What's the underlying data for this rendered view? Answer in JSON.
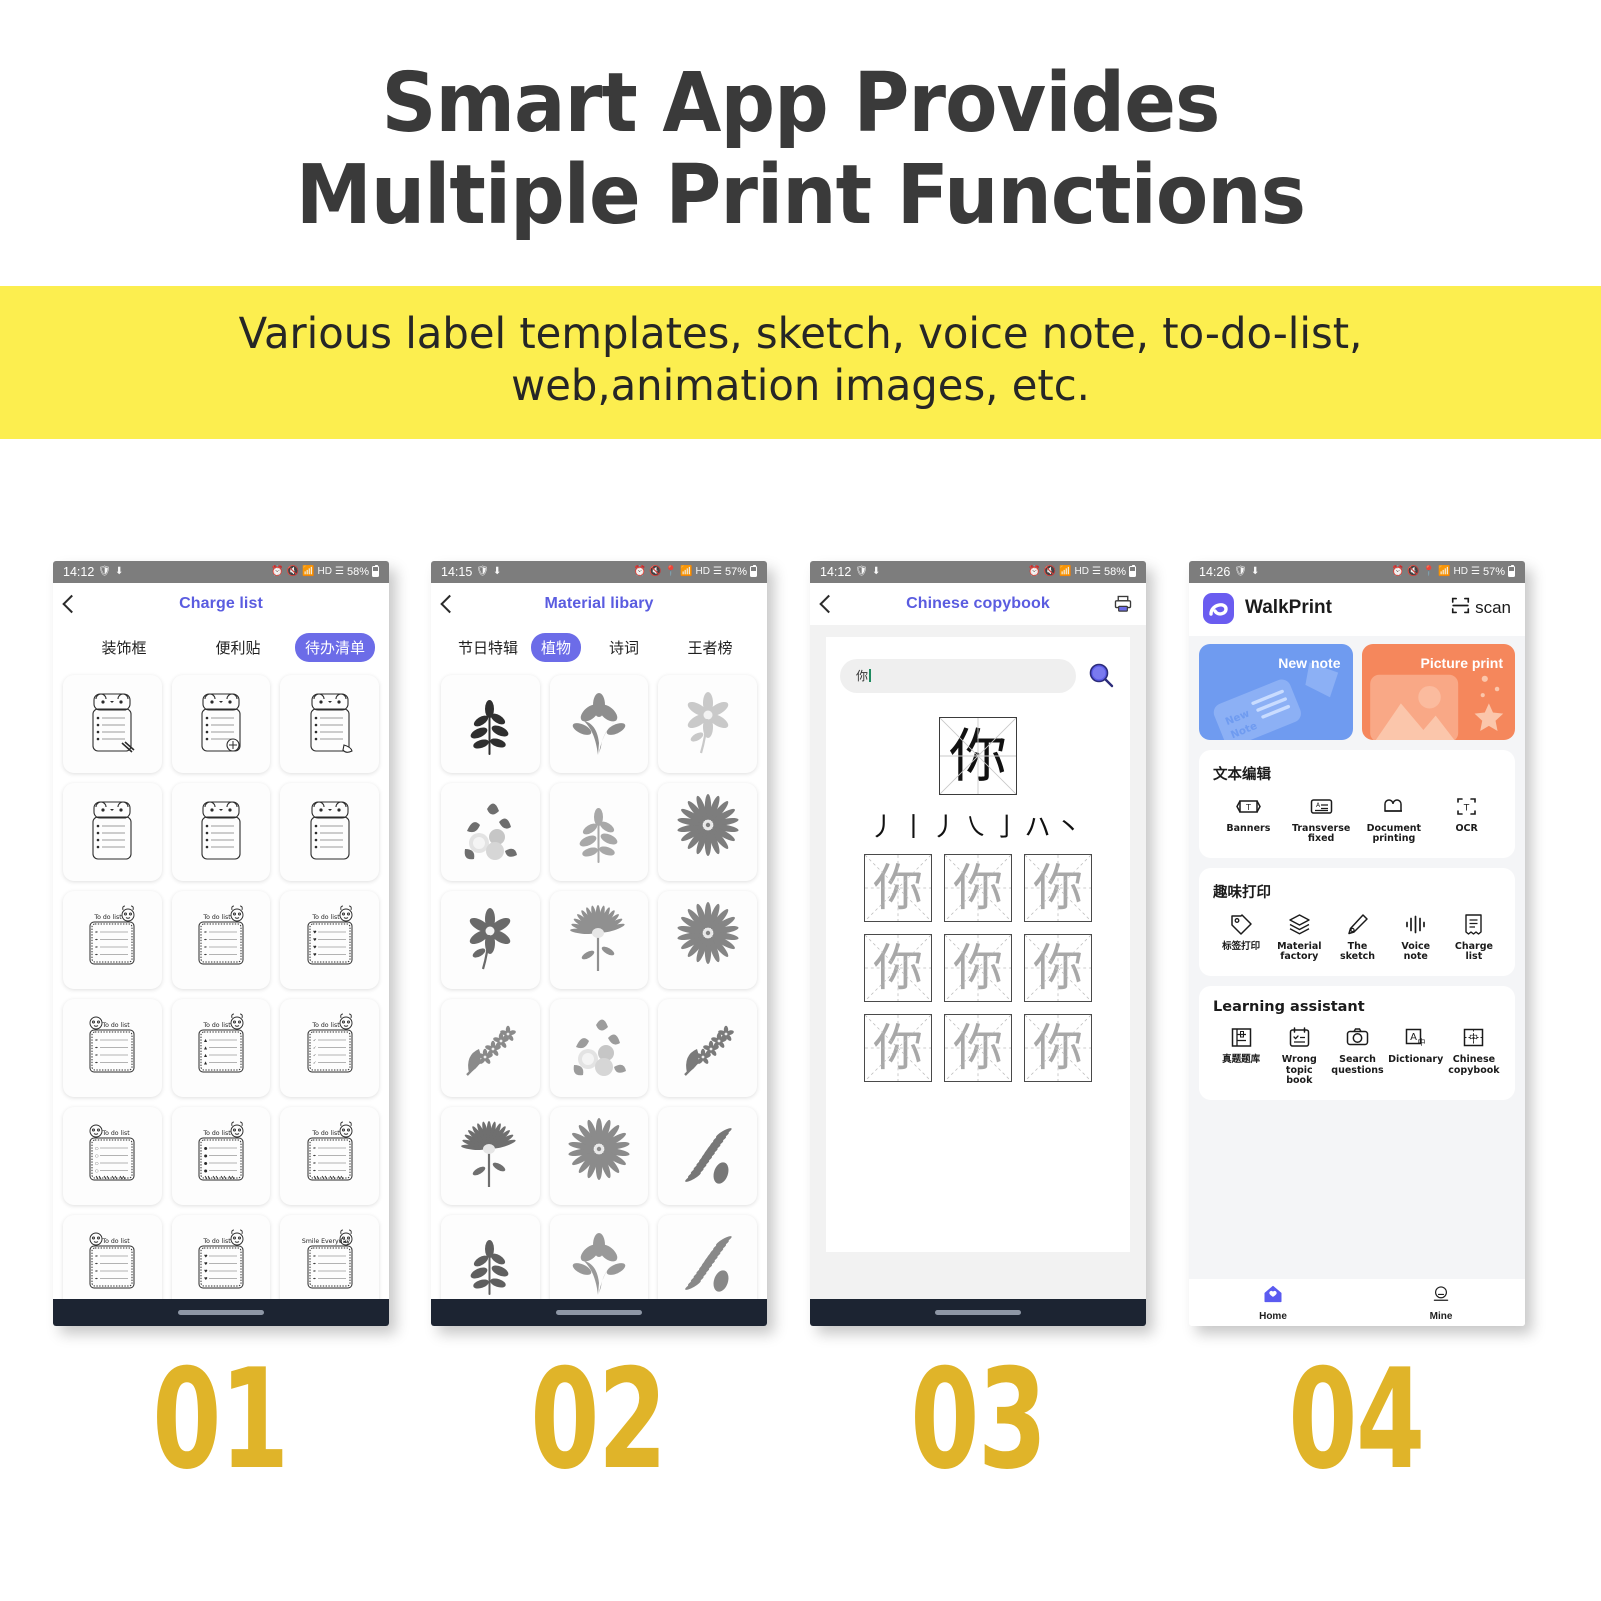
{
  "hero": {
    "title_line1": "Smart App Provides",
    "title_line2": "Multiple Print Functions",
    "subtitle_line1": "Various label templates, sketch, voice note, to-do-list,",
    "subtitle_line2": "web,animation images, etc."
  },
  "colors": {
    "band_yellow": "#fcee4f",
    "number_gold": "#e0b429",
    "accent_purple": "#5a5ce0",
    "tab_active": "#6c6ce8",
    "banner_blue": "#6f9bf0",
    "banner_orange": "#f5875c",
    "statusbar_gray": "#7d7d7d",
    "homebar_dark": "#1c2432"
  },
  "phones": [
    {
      "id": "01",
      "status": {
        "time": "14:12",
        "battery": "58%",
        "icons": [
          "shield-icon",
          "download-icon",
          "alarm-icon",
          "mute-icon",
          "wifi-icon",
          "hd-icon",
          "signal-icon"
        ]
      },
      "nav": {
        "title": "Charge list",
        "back": "back-chevron-icon"
      },
      "tabs": [
        {
          "label": "装饰框",
          "active": false
        },
        {
          "label": "便利贴",
          "active": false
        },
        {
          "label": "待办清单",
          "active": true
        }
      ],
      "cards_label": "To do list",
      "cards_label_alt": "Smile Everyday",
      "rows": 6
    },
    {
      "id": "02",
      "status": {
        "time": "14:15",
        "battery": "57%",
        "icons": [
          "shield-icon",
          "download-icon",
          "alarm-icon",
          "mute-icon",
          "location-icon",
          "wifi-icon",
          "hd-icon",
          "signal-icon"
        ]
      },
      "nav": {
        "title": "Material libary",
        "back": "back-chevron-icon"
      },
      "tabs": [
        {
          "label": "节日特辑",
          "active": false
        },
        {
          "label": "植物",
          "active": true
        },
        {
          "label": "诗词",
          "active": false
        },
        {
          "label": "王者榜",
          "active": false
        }
      ],
      "rows": 6
    },
    {
      "id": "03",
      "status": {
        "time": "14:12",
        "battery": "58%",
        "icons": [
          "shield-icon",
          "download-icon",
          "alarm-icon",
          "mute-icon",
          "wifi-icon",
          "hd-icon",
          "signal-icon"
        ]
      },
      "nav": {
        "title": "Chinese copybook",
        "back": "back-chevron-icon",
        "action": "printer-icon"
      },
      "search_value": "你",
      "character": "你",
      "strokes": "丿丨丿㇏亅ハ丶",
      "practice_char": "你",
      "practice_count": 9
    },
    {
      "id": "04",
      "status": {
        "time": "14:26",
        "battery": "57%",
        "icons": [
          "shield-icon",
          "download-icon",
          "alarm-icon",
          "mute-icon",
          "location-icon",
          "wifi-icon",
          "hd-icon",
          "signal-icon"
        ]
      },
      "app_name": "WalkPrint",
      "scan_label": "scan",
      "banners": [
        {
          "label": "New note",
          "color": "blue",
          "art": "note-illustration"
        },
        {
          "label": "Picture print",
          "color": "orange",
          "art": "picture-illustration"
        }
      ],
      "sections": [
        {
          "title": "文本编辑",
          "items": [
            {
              "label": "Banners",
              "icon": "banner-icon"
            },
            {
              "label": "Transverse fixed",
              "icon": "card-icon"
            },
            {
              "label": "Document printing",
              "icon": "document-printing-icon"
            },
            {
              "label": "OCR",
              "icon": "ocr-icon"
            }
          ]
        },
        {
          "title": "趣味打印",
          "items": [
            {
              "label": "标签打印",
              "icon": "tag-icon"
            },
            {
              "label": "Material factory",
              "icon": "layers-icon"
            },
            {
              "label": "The sketch",
              "icon": "pencil-icon"
            },
            {
              "label": "Voice note",
              "icon": "waveform-icon"
            },
            {
              "label": "Charge list",
              "icon": "checklist-icon"
            }
          ]
        },
        {
          "title": "Learning assistant",
          "items": [
            {
              "label": "真题题库",
              "icon": "book-icon"
            },
            {
              "label": "Wrong topic book",
              "icon": "notebook-icon"
            },
            {
              "label": "Search questions",
              "icon": "camera-icon"
            },
            {
              "label": "Dictionary",
              "icon": "dictionary-icon"
            },
            {
              "label": "Chinese copybook",
              "icon": "copybook-icon"
            }
          ]
        }
      ],
      "tabbar": [
        {
          "label": "Home",
          "icon": "home-icon",
          "active": true
        },
        {
          "label": "Mine",
          "icon": "person-icon",
          "active": false
        }
      ]
    }
  ],
  "numbers": [
    "01",
    "02",
    "03",
    "04"
  ]
}
